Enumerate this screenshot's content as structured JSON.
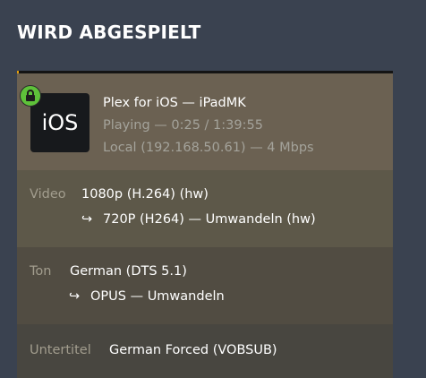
{
  "section": {
    "title": "WIRD ABGESPIELT"
  },
  "colors": {
    "progress": "#e5a00d",
    "lock_badge": "#5ec13a"
  },
  "session": {
    "progress_fraction": 0.0042,
    "app_icon_text": "iOS",
    "title": "Plex for iOS  —  iPadMK",
    "status": "Playing — 0:25 / 1:39:55",
    "network": "Local (192.168.50.61) — 4 Mbps",
    "lock_icon": "lock-icon"
  },
  "streams": {
    "video": {
      "label": "Video",
      "source": "1080p (H.264) (hw)",
      "arrow": "↪",
      "target": "720P (H264) — Umwandeln (hw)"
    },
    "audio": {
      "label": "Ton",
      "source": "German (DTS 5.1)",
      "arrow": "↪",
      "target": "OPUS — Umwandeln"
    },
    "subtitle": {
      "label": "Untertitel",
      "source": "German Forced (VOBSUB)"
    }
  }
}
